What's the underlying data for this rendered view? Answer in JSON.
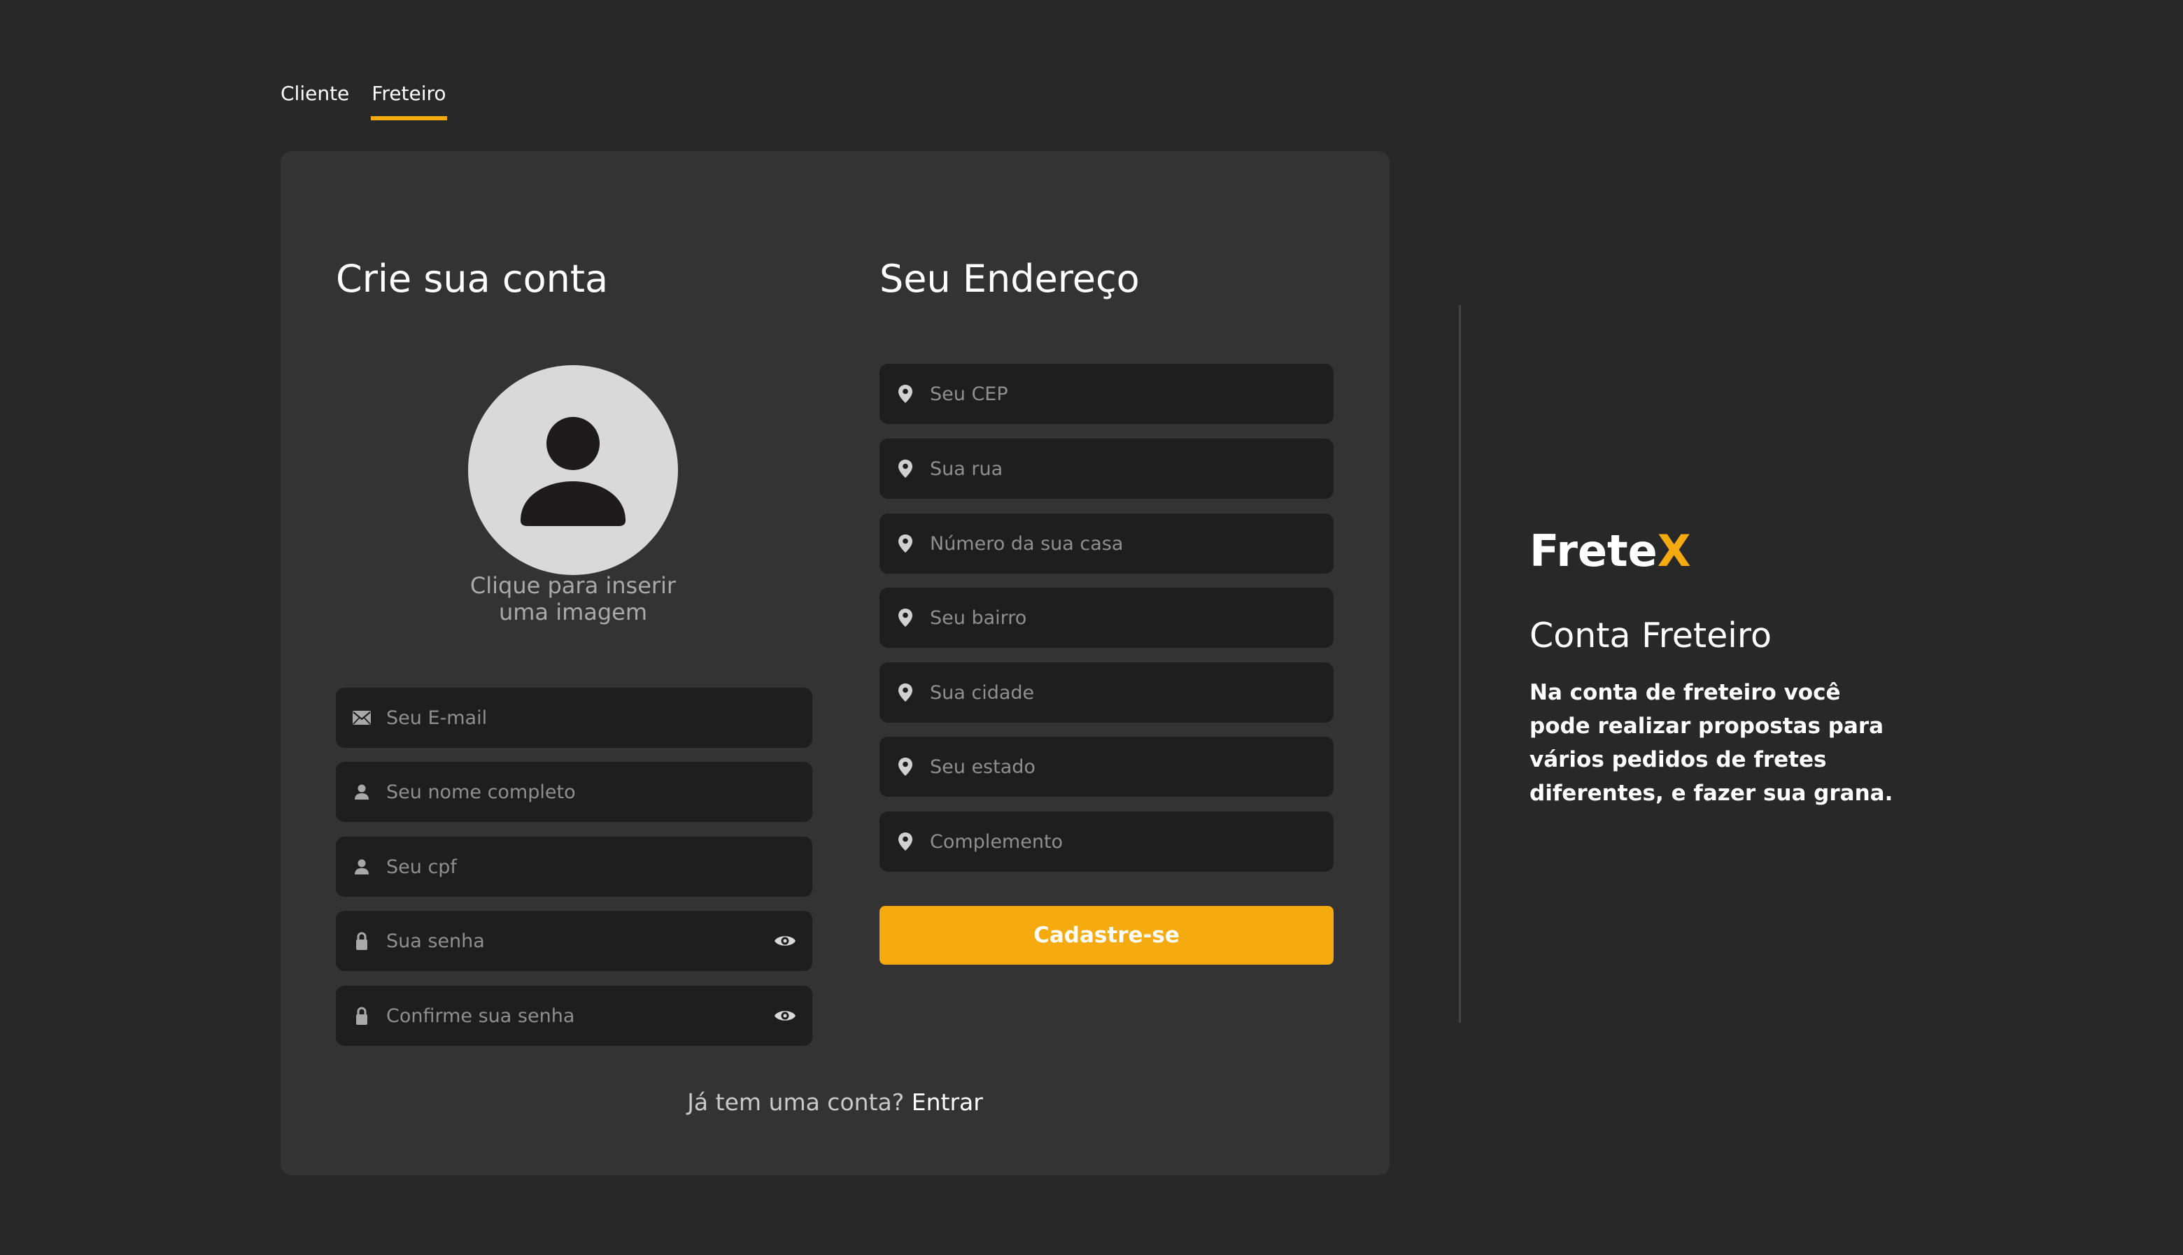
{
  "tabs": [
    {
      "label": "Cliente",
      "active": false
    },
    {
      "label": "Freteiro",
      "active": true
    }
  ],
  "form": {
    "title": "Crie sua conta",
    "avatar_caption_line1": "Clique para inserir",
    "avatar_caption_line2": "uma imagem",
    "email_placeholder": "Seu E-mail",
    "name_placeholder": "Seu nome completo",
    "cpf_placeholder": "Seu cpf",
    "password_placeholder": "Sua senha",
    "confirm_password_placeholder": "Confirme sua senha"
  },
  "address": {
    "title": "Seu Endereço",
    "cep_placeholder": "Seu CEP",
    "street_placeholder": "Sua rua",
    "number_placeholder": "Número da sua casa",
    "neighborhood_placeholder": "Seu bairro",
    "city_placeholder": "Sua cidade",
    "state_placeholder": "Seu estado",
    "complement_placeholder": "Complemento"
  },
  "submit_label": "Cadastre-se",
  "login": {
    "prompt": "Já tem uma conta?",
    "link": "Entrar"
  },
  "info": {
    "brand_main": "Frete",
    "brand_accent": "X",
    "title": "Conta Freteiro",
    "description": "Na conta de freteiro você pode realizar propostas para vários pedidos de fretes diferentes, e fazer sua grana."
  },
  "colors": {
    "background": "#282828",
    "card": "#333333",
    "input": "#1e1e1e",
    "accent": "#f5aa10",
    "placeholder": "#8f8f8f"
  },
  "icons": {
    "email": "envelope-icon",
    "name": "user-icon",
    "cpf": "user-icon",
    "password": "lock-icon",
    "toggle": "eye-icon",
    "address": "map-pin-icon",
    "avatar": "user-silhouette-icon"
  }
}
